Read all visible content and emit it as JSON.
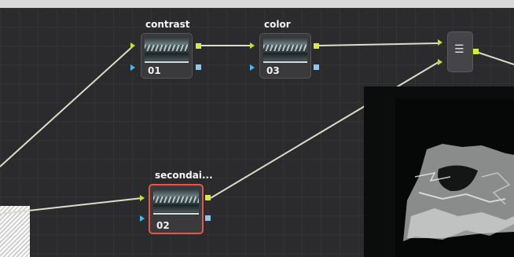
{
  "node_editor": {
    "nodes": [
      {
        "title": "contrast",
        "id": "01",
        "selected": false
      },
      {
        "title": "color",
        "id": "03",
        "selected": false
      },
      {
        "title": "secondai...",
        "id": "02",
        "selected": true
      }
    ],
    "layer_mixer_icon": "layers-icon"
  },
  "colors": {
    "selected_border": "#e2574a",
    "port_green": "#d7ec3c",
    "port_blue": "#8cc9ef",
    "wire": "#dcdcc8"
  }
}
